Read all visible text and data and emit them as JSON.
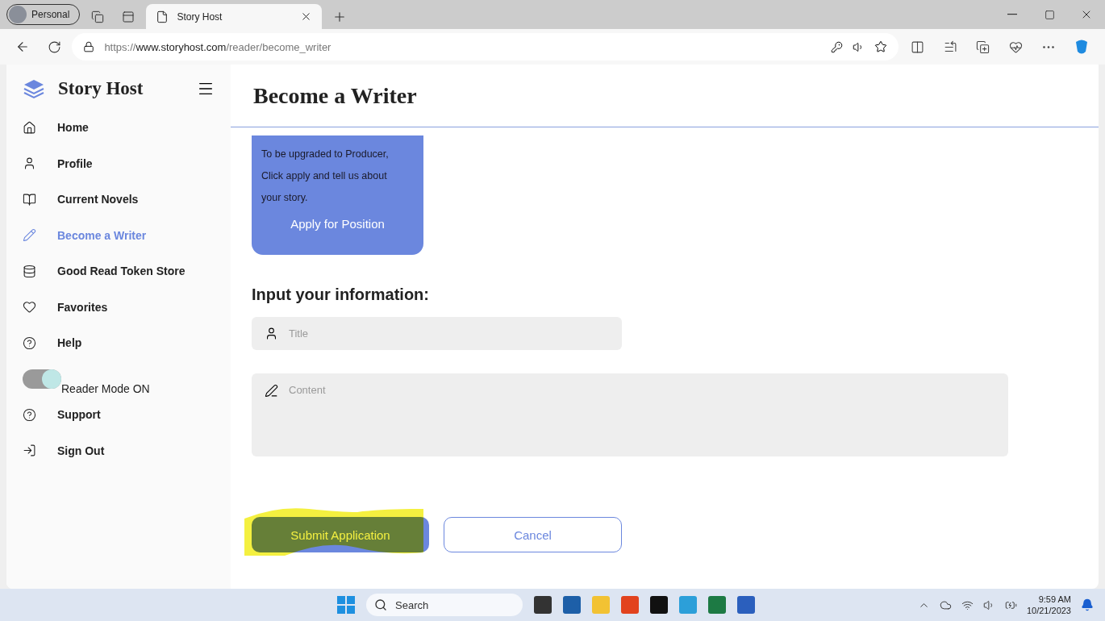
{
  "browser": {
    "profile": "Personal",
    "tabs": [
      {
        "label": "Story Host",
        "selected": true
      }
    ],
    "url": {
      "scheme": "https://",
      "domain": "www.storyhost.com",
      "path": "/reader/become_writer"
    }
  },
  "sidebar": {
    "brand": "Story Host",
    "items": [
      {
        "kind": "link",
        "label": "Home",
        "selected": false
      },
      {
        "kind": "link",
        "label": "Profile",
        "selected": false
      },
      {
        "kind": "link",
        "label": "Current Novels",
        "selected": false
      },
      {
        "kind": "link",
        "label": "Become a Writer",
        "selected": true
      },
      {
        "kind": "link",
        "label": "Good Read Token Store",
        "selected": false
      },
      {
        "kind": "link",
        "label": "Favorites",
        "selected": false
      },
      {
        "kind": "link",
        "label": "Help",
        "selected": false
      },
      {
        "kind": "toggle",
        "label": "Reader Mode ON",
        "on": true
      },
      {
        "kind": "link",
        "label": "Support",
        "selected": false
      },
      {
        "kind": "link",
        "label": "Sign Out",
        "selected": false
      }
    ]
  },
  "main": {
    "title": "Become a Writer",
    "card": {
      "lines": [
        "To be upgraded to Producer,",
        "Click apply and tell us about",
        "your story."
      ],
      "button": "Apply for Position"
    },
    "form": {
      "heading": "Input your information:",
      "fields": [
        {
          "kind": "single",
          "placeholder": "Title"
        },
        {
          "kind": "multi",
          "placeholder": "Content"
        }
      ],
      "buttons": [
        {
          "kind": "primary",
          "label": "Submit Application",
          "highlighted": true
        },
        {
          "kind": "outline",
          "label": "Cancel",
          "highlighted": false
        }
      ]
    }
  },
  "taskbar": {
    "search": "Search",
    "time": "9:59 AM",
    "date": "10/21/2023"
  }
}
